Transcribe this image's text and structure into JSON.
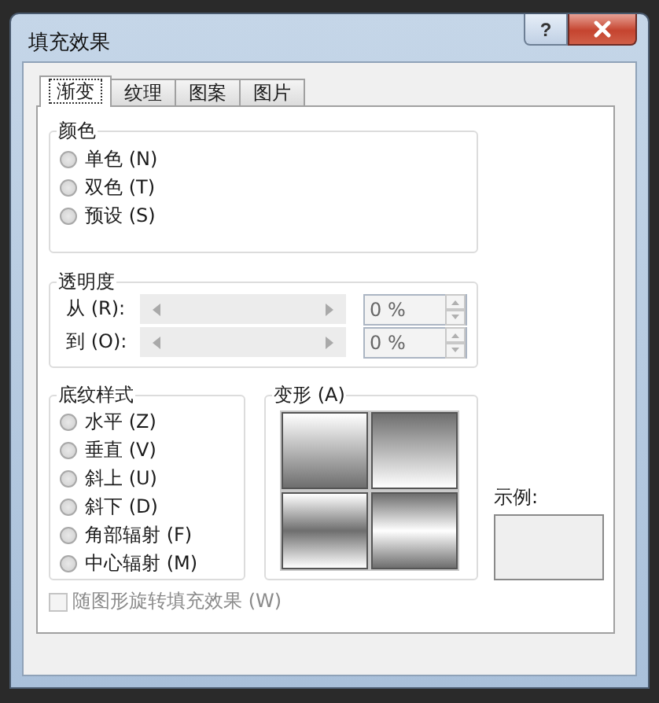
{
  "window": {
    "title": "填充效果",
    "help": "?"
  },
  "tabs": [
    {
      "label": "渐变",
      "selected": true
    },
    {
      "label": "纹理",
      "selected": false
    },
    {
      "label": "图案",
      "selected": false
    },
    {
      "label": "图片",
      "selected": false
    }
  ],
  "colors": {
    "title": "颜色",
    "options": [
      {
        "label": "单色 (N)",
        "selected": false
      },
      {
        "label": "双色 (T)",
        "selected": false
      },
      {
        "label": "预设 (S)",
        "selected": false
      }
    ]
  },
  "transparency": {
    "title": "透明度",
    "rows": [
      {
        "label": "从 (R):",
        "value": "0 %",
        "disabled": true
      },
      {
        "label": "到 (O):",
        "value": "0 %",
        "disabled": true
      }
    ]
  },
  "shading_styles": {
    "title": "底纹样式",
    "options": [
      {
        "label": "水平 (Z)",
        "selected": false
      },
      {
        "label": "垂直 (V)",
        "selected": false
      },
      {
        "label": "斜上 (U)",
        "selected": false
      },
      {
        "label": "斜下 (D)",
        "selected": false
      },
      {
        "label": "角部辐射 (F)",
        "selected": false
      },
      {
        "label": "中心辐射 (M)",
        "selected": false
      }
    ]
  },
  "variants": {
    "title": "变形 (A)",
    "items": [
      {
        "kind": "fade-down",
        "selected": false
      },
      {
        "kind": "fade-up",
        "selected": false
      },
      {
        "kind": "dark-middle",
        "selected": false
      },
      {
        "kind": "light-middle",
        "selected": false
      }
    ]
  },
  "sample": {
    "label": "示例:"
  },
  "rotate_with_shape": {
    "label": "随图形旋转填充效果 (W)",
    "checked": false,
    "disabled": true
  }
}
